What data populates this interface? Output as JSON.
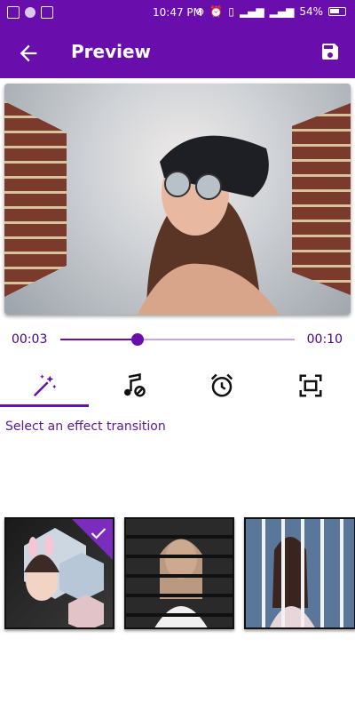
{
  "status": {
    "time": "10:47 PM",
    "battery": "54%"
  },
  "appbar": {
    "title": "Preview"
  },
  "player": {
    "current_time": "00:03",
    "total_time": "00:10",
    "progress": 0.33
  },
  "tabs": [
    {
      "icon": "magic-wand-icon",
      "selected": true
    },
    {
      "icon": "music-off-icon",
      "selected": false
    },
    {
      "icon": "alarm-clock-icon",
      "selected": false
    },
    {
      "icon": "crop-frame-icon",
      "selected": false
    }
  ],
  "instruction": "Select an effect transition",
  "effects": [
    {
      "name": "hexagon-collage",
      "selected": true
    },
    {
      "name": "horizontal-stripes",
      "selected": false
    },
    {
      "name": "vertical-stripes",
      "selected": false
    }
  ],
  "colors": {
    "primary": "#6a0dad",
    "accent_text": "#5b1a99",
    "track": "#c6a6e6"
  }
}
